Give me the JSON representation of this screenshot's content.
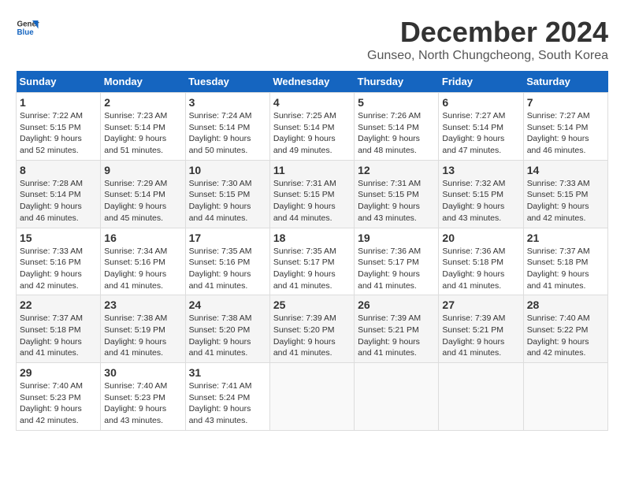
{
  "logo": {
    "line1": "General",
    "line2": "Blue"
  },
  "title": "December 2024",
  "subtitle": "Gunseo, North Chungcheong, South Korea",
  "days_of_week": [
    "Sunday",
    "Monday",
    "Tuesday",
    "Wednesday",
    "Thursday",
    "Friday",
    "Saturday"
  ],
  "weeks": [
    [
      {
        "day": "1",
        "sunrise": "7:22 AM",
        "sunset": "5:15 PM",
        "daylight": "9 hours and 52 minutes."
      },
      {
        "day": "2",
        "sunrise": "7:23 AM",
        "sunset": "5:14 PM",
        "daylight": "9 hours and 51 minutes."
      },
      {
        "day": "3",
        "sunrise": "7:24 AM",
        "sunset": "5:14 PM",
        "daylight": "9 hours and 50 minutes."
      },
      {
        "day": "4",
        "sunrise": "7:25 AM",
        "sunset": "5:14 PM",
        "daylight": "9 hours and 49 minutes."
      },
      {
        "day": "5",
        "sunrise": "7:26 AM",
        "sunset": "5:14 PM",
        "daylight": "9 hours and 48 minutes."
      },
      {
        "day": "6",
        "sunrise": "7:27 AM",
        "sunset": "5:14 PM",
        "daylight": "9 hours and 47 minutes."
      },
      {
        "day": "7",
        "sunrise": "7:27 AM",
        "sunset": "5:14 PM",
        "daylight": "9 hours and 46 minutes."
      }
    ],
    [
      {
        "day": "8",
        "sunrise": "7:28 AM",
        "sunset": "5:14 PM",
        "daylight": "9 hours and 46 minutes."
      },
      {
        "day": "9",
        "sunrise": "7:29 AM",
        "sunset": "5:14 PM",
        "daylight": "9 hours and 45 minutes."
      },
      {
        "day": "10",
        "sunrise": "7:30 AM",
        "sunset": "5:15 PM",
        "daylight": "9 hours and 44 minutes."
      },
      {
        "day": "11",
        "sunrise": "7:31 AM",
        "sunset": "5:15 PM",
        "daylight": "9 hours and 44 minutes."
      },
      {
        "day": "12",
        "sunrise": "7:31 AM",
        "sunset": "5:15 PM",
        "daylight": "9 hours and 43 minutes."
      },
      {
        "day": "13",
        "sunrise": "7:32 AM",
        "sunset": "5:15 PM",
        "daylight": "9 hours and 43 minutes."
      },
      {
        "day": "14",
        "sunrise": "7:33 AM",
        "sunset": "5:15 PM",
        "daylight": "9 hours and 42 minutes."
      }
    ],
    [
      {
        "day": "15",
        "sunrise": "7:33 AM",
        "sunset": "5:16 PM",
        "daylight": "9 hours and 42 minutes."
      },
      {
        "day": "16",
        "sunrise": "7:34 AM",
        "sunset": "5:16 PM",
        "daylight": "9 hours and 41 minutes."
      },
      {
        "day": "17",
        "sunrise": "7:35 AM",
        "sunset": "5:16 PM",
        "daylight": "9 hours and 41 minutes."
      },
      {
        "day": "18",
        "sunrise": "7:35 AM",
        "sunset": "5:17 PM",
        "daylight": "9 hours and 41 minutes."
      },
      {
        "day": "19",
        "sunrise": "7:36 AM",
        "sunset": "5:17 PM",
        "daylight": "9 hours and 41 minutes."
      },
      {
        "day": "20",
        "sunrise": "7:36 AM",
        "sunset": "5:18 PM",
        "daylight": "9 hours and 41 minutes."
      },
      {
        "day": "21",
        "sunrise": "7:37 AM",
        "sunset": "5:18 PM",
        "daylight": "9 hours and 41 minutes."
      }
    ],
    [
      {
        "day": "22",
        "sunrise": "7:37 AM",
        "sunset": "5:18 PM",
        "daylight": "9 hours and 41 minutes."
      },
      {
        "day": "23",
        "sunrise": "7:38 AM",
        "sunset": "5:19 PM",
        "daylight": "9 hours and 41 minutes."
      },
      {
        "day": "24",
        "sunrise": "7:38 AM",
        "sunset": "5:20 PM",
        "daylight": "9 hours and 41 minutes."
      },
      {
        "day": "25",
        "sunrise": "7:39 AM",
        "sunset": "5:20 PM",
        "daylight": "9 hours and 41 minutes."
      },
      {
        "day": "26",
        "sunrise": "7:39 AM",
        "sunset": "5:21 PM",
        "daylight": "9 hours and 41 minutes."
      },
      {
        "day": "27",
        "sunrise": "7:39 AM",
        "sunset": "5:21 PM",
        "daylight": "9 hours and 41 minutes."
      },
      {
        "day": "28",
        "sunrise": "7:40 AM",
        "sunset": "5:22 PM",
        "daylight": "9 hours and 42 minutes."
      }
    ],
    [
      {
        "day": "29",
        "sunrise": "7:40 AM",
        "sunset": "5:23 PM",
        "daylight": "9 hours and 42 minutes."
      },
      {
        "day": "30",
        "sunrise": "7:40 AM",
        "sunset": "5:23 PM",
        "daylight": "9 hours and 43 minutes."
      },
      {
        "day": "31",
        "sunrise": "7:41 AM",
        "sunset": "5:24 PM",
        "daylight": "9 hours and 43 minutes."
      },
      null,
      null,
      null,
      null
    ]
  ]
}
